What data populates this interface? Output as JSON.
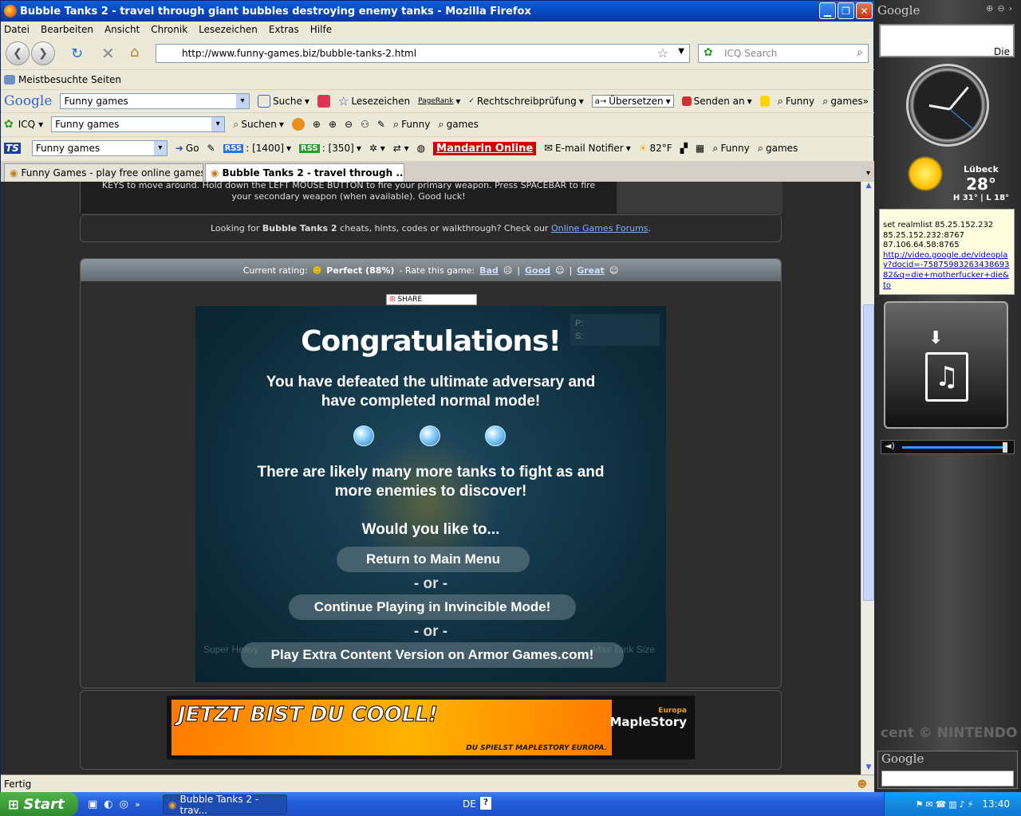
{
  "window": {
    "title": "Bubble Tanks 2 - travel through giant bubbles destroying enemy tanks - Mozilla Firefox"
  },
  "menu": [
    "Datei",
    "Bearbeiten",
    "Ansicht",
    "Chronik",
    "Lesezeichen",
    "Extras",
    "Hilfe"
  ],
  "nav": {
    "url": "http://www.funny-games.biz/bubble-tanks-2.html",
    "search_placeholder": "ICQ Search"
  },
  "bookmarks": {
    "most_visited": "Meistbesuchte Seiten"
  },
  "google_toolbar": {
    "logo": "Google",
    "query": "Funny games",
    "suche": "Suche",
    "lesezeichen": "Lesezeichen",
    "pagerank": "PageRank",
    "spell": "Rechtschreibprüfung",
    "translate": "Übersetzen",
    "send": "Senden an",
    "funny": "Funny",
    "games": "games"
  },
  "icq_toolbar": {
    "icq": "ICQ",
    "query": "Funny games",
    "suchen": "Suchen",
    "funny": "Funny",
    "games": "games"
  },
  "third_toolbar": {
    "query": "Funny games",
    "go": "Go",
    "rss1": "RSS",
    "count1": ": [1400]",
    "rss2": "RSS",
    "count2": ": [350]",
    "mandarin": "Mandarin Online",
    "email": "E-mail Notifier",
    "temp": "82°F",
    "funny": "Funny",
    "games": "games"
  },
  "tabs": [
    {
      "label": "Funny Games - play free online games ..."
    },
    {
      "label": "Bubble Tanks 2 - travel through ..."
    }
  ],
  "page": {
    "instructions_1": "KEYS to move around. Hold down the LEFT MOUSE BUTTON to fire your primary weapon. Press SPACEBAR to fire",
    "instructions_2": "your secondary weapon (when available). Good luck!",
    "cheats_pre": "Looking for ",
    "cheats_game": "Bubble Tanks 2",
    "cheats_mid": " cheats, hints, codes or walkthrough? Check our ",
    "cheats_link": "Online Games Forums",
    "cheats_end": ".",
    "rating_label": "Current rating:",
    "rating_value": "Perfect (88%)",
    "rate_label": "- Rate this game:",
    "rate_bad": "Bad",
    "rate_good": "Good",
    "rate_great": "Great",
    "share": "SHARE"
  },
  "game": {
    "title": "Congratulations!",
    "line1": "You have defeated the ultimate adversary and",
    "line2": "have completed normal mode!",
    "line3": "There are likely many more tanks to fight as and",
    "line4": "more enemies to discover!",
    "question": "Would you like to...",
    "btn_menu": "Return to Main Menu",
    "or1": "- or -",
    "btn_invincible": "Continue Playing in Invincible Mode!",
    "or2": "- or -",
    "btn_armor": "Play Extra Content Version on Armor Games.com!",
    "hud_p": "P:",
    "hud_s": "S:",
    "faded_left": "Super Heavy",
    "faded_right": "Max Tank Size"
  },
  "ad": {
    "headline": "JETZT BIST DU COOLL!",
    "sub": "DU SPIELST MAPLESTORY EUROPA.",
    "brand": "MapleStory",
    "brand_tag": "Europa"
  },
  "status": {
    "text": "Fertig"
  },
  "sidebar": {
    "google": "Google",
    "search_text": "Die",
    "city": "Lübeck",
    "temp": "28°",
    "hilo": "H 31° | L 18°",
    "note": [
      "set realmlist 85.25.152.232",
      "85.25.152.232:8767",
      "87.106.64.58:8765"
    ],
    "note_link": "http://video.google.de/videoplay?docid=-7587598326343869382&q=die+motherfucker+die&to",
    "nintendo": "cent © NINTENDO",
    "google2": "Google"
  },
  "taskbar": {
    "start": "Start",
    "task": "Bubble Tanks 2 - trav...",
    "lang": "DE",
    "time": "13:40"
  }
}
